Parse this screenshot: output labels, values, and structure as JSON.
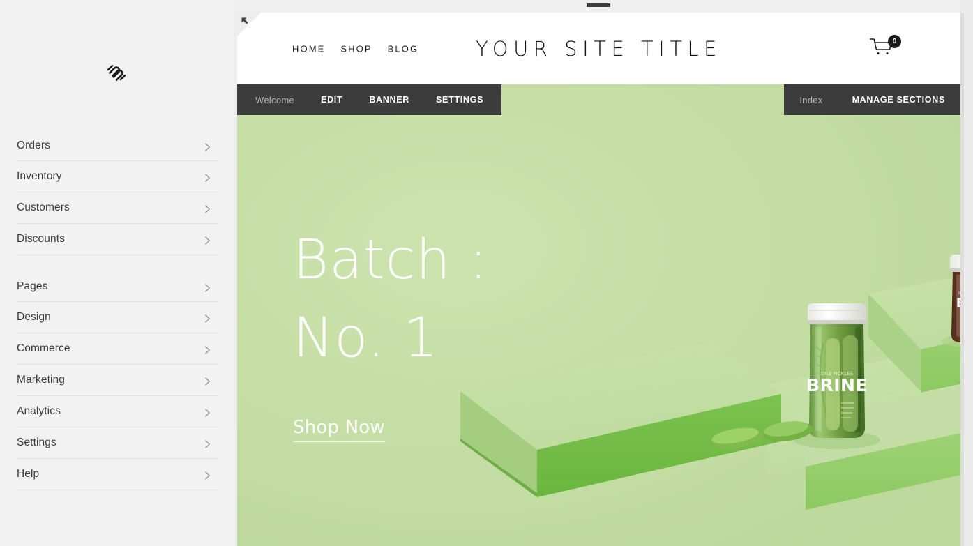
{
  "app": {
    "logo_name": "squarespace-logo",
    "sidebar_bg": "#f2f2f2",
    "accent_dark": "#3c3c3c"
  },
  "sidebar": {
    "groups": [
      {
        "name": "commerce-group",
        "items": [
          {
            "label": "Orders"
          },
          {
            "label": "Inventory"
          },
          {
            "label": "Customers"
          },
          {
            "label": "Discounts"
          }
        ]
      },
      {
        "name": "site-group",
        "items": [
          {
            "label": "Pages"
          },
          {
            "label": "Design"
          },
          {
            "label": "Commerce"
          },
          {
            "label": "Marketing"
          },
          {
            "label": "Analytics"
          },
          {
            "label": "Settings"
          },
          {
            "label": "Help"
          }
        ]
      }
    ]
  },
  "editor_toolbar": {
    "context_label": "Welcome",
    "actions": [
      {
        "label": "EDIT"
      },
      {
        "label": "BANNER"
      },
      {
        "label": "SETTINGS"
      }
    ],
    "right_context_label": "Index",
    "right_action": "MANAGE SECTIONS"
  },
  "site": {
    "nav": [
      {
        "label": "HOME"
      },
      {
        "label": "SHOP"
      },
      {
        "label": "BLOG"
      }
    ],
    "title": "YOUR SITE TITLE",
    "cart": {
      "count": "0",
      "icon": "shopping-cart-icon"
    }
  },
  "hero": {
    "headline_line1": "Batch :",
    "headline_line2": "No. 1",
    "cta_label": "Shop Now",
    "background_color": "#c0da9f",
    "image_alt": "Pickle jars labeled BRINE on green pedestals with cucumbers, beet and carrot sticks"
  }
}
